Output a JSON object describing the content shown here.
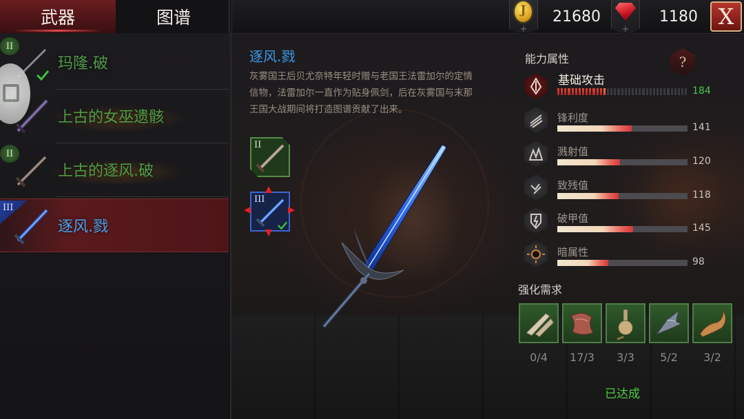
{
  "tabs": {
    "weapons": "武器",
    "atlas": "图谱"
  },
  "currency": {
    "gold": "21680",
    "gems": "1180",
    "gold_icon": "gold-coin-icon",
    "gem_icon": "red-gem-icon"
  },
  "close_label": "X",
  "weapon_list": [
    {
      "name": "玛隆.破",
      "tier": "II",
      "tier_color": "green",
      "checked": true
    },
    {
      "name": "上古的女巫遗骸",
      "tier": "II",
      "tier_color": "green",
      "checked": false
    },
    {
      "name": "上古的逐风.破",
      "tier": "II",
      "tier_color": "green",
      "checked": false
    },
    {
      "name": "逐风.戮",
      "tier": "III",
      "tier_color": "blue",
      "checked": false,
      "selected": true
    }
  ],
  "weapon": {
    "name": "逐风.戮",
    "description": "灰雾国王后贝尤奈特年轻时赠与老国王法雷加尔的定情信物，法雷加尔一直作为贴身佩剑，后在灰雾国与末那王国大战期间将打造图谱贡献了出来。",
    "variants": [
      {
        "tier": "II",
        "color": "green"
      },
      {
        "tier": "III",
        "color": "blue",
        "equipped": true
      }
    ]
  },
  "attributes": {
    "title": "能力属性",
    "help_label": "?",
    "base": {
      "name": "基础攻击",
      "value": "184",
      "filled_segments": 14,
      "total_segments": 37
    },
    "stats": [
      {
        "name": "锋利度",
        "value": "141",
        "fill": 0.57,
        "icon": "blades-icon"
      },
      {
        "name": "溅射值",
        "value": "120",
        "fill": 0.48,
        "icon": "splash-icon"
      },
      {
        "name": "致残值",
        "value": "118",
        "fill": 0.47,
        "icon": "cripple-icon"
      },
      {
        "name": "破甲值",
        "value": "145",
        "fill": 0.58,
        "icon": "armor-break-icon"
      },
      {
        "name": "暗属性",
        "value": "98",
        "fill": 0.39,
        "icon": "dark-element-icon"
      }
    ]
  },
  "enhance": {
    "title": "强化需求",
    "materials": [
      {
        "count": "0/4",
        "icon": "bone-material-icon"
      },
      {
        "count": "17/3",
        "icon": "flesh-material-icon"
      },
      {
        "count": "3/3",
        "icon": "potion-material-icon"
      },
      {
        "count": "5/2",
        "icon": "steel-shard-material-icon"
      },
      {
        "count": "3/2",
        "icon": "horn-material-icon"
      }
    ],
    "status": "已达成"
  },
  "colors": {
    "green_name": "#4f9b47",
    "blue_name": "#3a9bea",
    "accent_red": "#6a1d1f",
    "value_green": "#4fc84a"
  }
}
